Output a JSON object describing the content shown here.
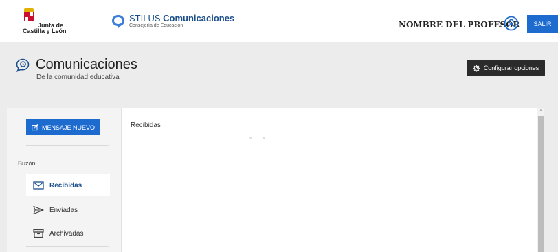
{
  "header": {
    "logo": {
      "line1": "Junta de",
      "line2": "Castilla y León"
    },
    "brand": {
      "title_light": "STILUS",
      "title_bold": "Comunicaciones",
      "subtitle": "Consejería de Educación"
    },
    "user_name": "NOMBRE DEL PROFESOR",
    "logout_label": "SALIR",
    "colors": {
      "accent": "#1e6bd0",
      "brand_text": "#1b4f8c"
    }
  },
  "page": {
    "title": "Comunicaciones",
    "subtitle": "De la comunidad educativa",
    "config_label": "Configurar opciones"
  },
  "sidebar": {
    "new_message_label": "MENSAJE NUEVO",
    "section_label": "Buzón",
    "items": [
      {
        "label": "Recibidas",
        "icon": "envelope-icon",
        "active": true
      },
      {
        "label": "Enviadas",
        "icon": "send-icon",
        "active": false
      },
      {
        "label": "Archivadas",
        "icon": "archive-icon",
        "active": false
      }
    ]
  },
  "message_list": {
    "title": "Recibidas",
    "prev": "«",
    "next": "»"
  }
}
